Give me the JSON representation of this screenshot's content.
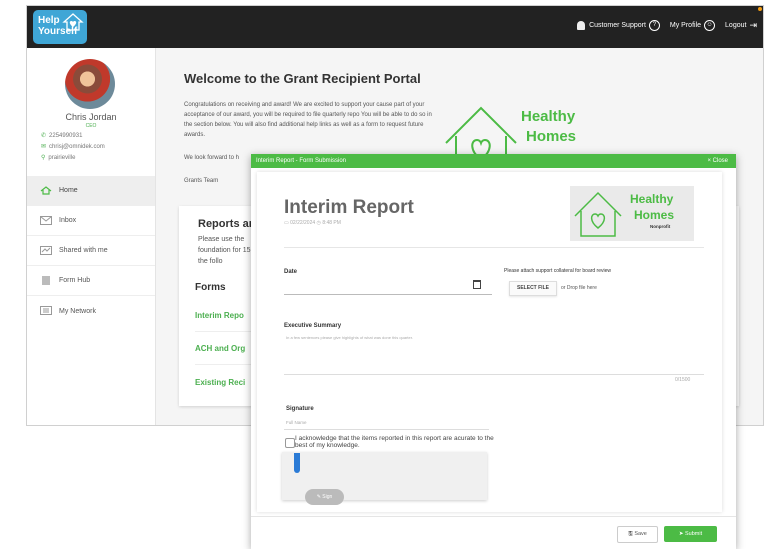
{
  "header": {
    "logo_line1": "Help",
    "logo_line2": "Yourself",
    "customer_support": "Customer Support",
    "customer_support_icon": "?",
    "my_profile": "My Profile",
    "logout": "Logout"
  },
  "profile": {
    "name": "Chris Jordan",
    "role": "CEO",
    "phone": "2254990931",
    "email": "chrisj@omnidek.com",
    "location": "prairieville"
  },
  "sidebar": {
    "items": [
      {
        "label": "Home"
      },
      {
        "label": "Inbox"
      },
      {
        "label": "Shared with me"
      },
      {
        "label": "Form Hub"
      },
      {
        "label": "My Network"
      }
    ]
  },
  "main": {
    "title": "Welcome to the Grant Recipient Portal",
    "intro": "Congratulations on receiving and award! We are excited to support your cause part of your acceptance of our award, you will be required to file quarterly repo You will be able to do so in the section below. You will also find additional help links as well as a form to request future awards.",
    "look_forward": "We look forward to h",
    "signoff": "Grants Team",
    "reports_heading": "Reports an",
    "reports_text": "Please use the foundation for 15 of the follo",
    "forms_heading": "Forms",
    "form_links": [
      "Interim Repo",
      "ACH and Org",
      "Existing Reci"
    ]
  },
  "brand": {
    "line1": "Healthy",
    "line2": "Homes",
    "tag": "Nonprofit"
  },
  "modal": {
    "header_title": "Interim Report - Form Submission",
    "close_label": "× Close",
    "report_title": "Interim Report",
    "date_stamp": "02/22/2024",
    "time_stamp": "8:48 PM",
    "date_label": "Date",
    "attach_label": "Please attach support collateral for board review",
    "select_file": "SELECT FILE",
    "drop_text": "or Drop file here",
    "exec_label": "Executive Summary",
    "exec_placeholder": "In a few sentences please give highlights of what was done this quarter.",
    "char_counter": "0/1500",
    "signature_label": "Signature",
    "full_name_placeholder": "Full Name",
    "acknowledge": "I acknowledge that the items reported in this report are acurate to the best of my knowledge.",
    "sign_button": "Sign",
    "save_button": "Save",
    "submit_button": "Submit"
  },
  "colors": {
    "accent_green": "#4cbb45",
    "topbar": "#222222",
    "logo_blue": "#3fa6d6"
  }
}
